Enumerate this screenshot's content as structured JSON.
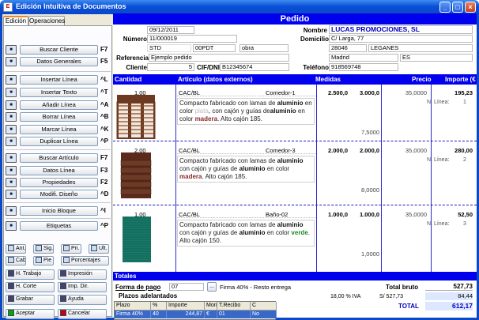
{
  "window": {
    "title": "Edición Intuitiva de Documentos"
  },
  "tabs": [
    "Edición",
    "Operaciones"
  ],
  "left_buttons": [
    {
      "label": "Buscar Cliente",
      "key": "F7",
      "icon": "client-search-icon"
    },
    {
      "label": "Datos Generales",
      "key": "F5",
      "icon": "general-data-icon"
    },
    {
      "label": "Insertar Línea",
      "key": "^L",
      "icon": "insert-line-icon"
    },
    {
      "label": "Insertar Texto",
      "key": "^T",
      "icon": "insert-text-icon"
    },
    {
      "label": "Añadir Línea",
      "key": "^A",
      "icon": "add-line-icon"
    },
    {
      "label": "Borrar Línea",
      "key": "^B",
      "icon": "delete-line-icon"
    },
    {
      "label": "Marcar Línea",
      "key": "^K",
      "icon": "mark-line-icon"
    },
    {
      "label": "Duplicar Línea",
      "key": "^P",
      "icon": "duplicate-line-icon"
    },
    {
      "label": "Buscar Artículo",
      "key": "F7",
      "icon": "article-search-icon"
    },
    {
      "label": "Datos Línea",
      "key": "F3",
      "icon": "line-data-icon"
    },
    {
      "label": "Propiedades",
      "key": "F2",
      "icon": "properties-icon"
    },
    {
      "label": "Modifi. Diseño",
      "key": "^D",
      "icon": "design-icon"
    },
    {
      "label": "Inicio Bloque",
      "key": "^I",
      "icon": "block-start-icon"
    },
    {
      "label": "Etiquetas",
      "key": "^P",
      "icon": "labels-icon"
    }
  ],
  "nav_buttons": [
    "Ant.",
    "Sig.",
    "Pri.",
    "Ult.",
    "Cab.",
    "Pie",
    "Porcentajes"
  ],
  "bottom_buttons": [
    "H. Trabajo",
    "Impresión",
    "H. Corte",
    "Imp. Dir.",
    "Grabar",
    "Ayuda",
    "Aceptar",
    "Cancelar"
  ],
  "header": {
    "title": "Pedido",
    "fecha_label": "Fecha",
    "fecha": "09/12/2011",
    "numero_label": "Número",
    "numero": "11/000019",
    "std": "STD",
    "ptd": "00PDT",
    "obra": "obra",
    "ref_label": "Referencia",
    "ref": "Ejemplo pedido",
    "cliente_label": "Cliente",
    "cliente": "5",
    "cif_label": "CIF/DNI",
    "cif": "B12345674",
    "nombre_label": "Nombre",
    "nombre": "LUCAS PROMOCIONES, SL",
    "domicilio_label": "Domicilio",
    "domicilio": "C/ Larga, 77",
    "cp": "28046",
    "ciudad": "LEGANES",
    "provincia": "Madrid",
    "pais": "ES",
    "telefono_label": "Teléfono",
    "telefono": "918569748"
  },
  "columns": [
    "Cantidad",
    "Artículo (datos externos)",
    "Medidas",
    "Precio",
    "Importe (€"
  ],
  "lines": [
    {
      "qty": "1,00",
      "code": "CAC/BL",
      "ref": "Comedor-1",
      "w": "2.500,0",
      "h": "3.000,0",
      "price": "35,0000",
      "amount": "195,23",
      "nl_label": "N. Línea:",
      "nl": "1",
      "area": "7,5000",
      "d1": "Compacto fabricado con lamas de ",
      "d1b": "aluminio",
      "d2": " en color ",
      "d2c": "plata",
      "d3": ", con cajón y guías de",
      "d4b": "aluminio",
      "d4": " en color ",
      "d4c": "madera",
      "d5": ". Alto cajón 185."
    },
    {
      "qty": "2,00",
      "code": "CAC/BL",
      "ref": "Comedor-3",
      "w": "2.000,0",
      "h": "2.000,0",
      "price": "35,0000",
      "amount": "280,00",
      "nl_label": "N. Línea:",
      "nl": "2",
      "area": "8,0000",
      "d1": "Compacto fabricado con lamas de ",
      "d1b": "aluminio",
      "d2": " con cajón y guías de ",
      "d2b": "aluminio",
      "d3": " en",
      "d4": " color ",
      "d4c": "madera",
      "d5": ". Alto cajón 185."
    },
    {
      "qty": "1,00",
      "code": "CAC/BL",
      "ref": "Baño-02",
      "w": "1.000,0",
      "h": "1.000,0",
      "price": "35,0000",
      "amount": "52,50",
      "nl_label": "N. Línea:",
      "nl": "3",
      "area": "1,0000",
      "d1": "Compacto fabricado con lamas de ",
      "d1b": "aluminio",
      "d2": " con cajón y guías de ",
      "d2b": "aluminio",
      "d3": " en",
      "d4": " color ",
      "d4c": "verde",
      "d5": ". Alto cajón 150."
    }
  ],
  "totals": {
    "title": "Totales",
    "forma_pago_label": "Forma de pago",
    "forma_pago": "07",
    "forma_pago_desc": "Firma 40% - Resto entrega",
    "plazos_label": "Plazos adelantados",
    "iva": "18,00 % IVA",
    "bruto_label": "Total bruto",
    "bruto": "527,73",
    "s_label": "S/ 527,73",
    "iva_amount": "84,44",
    "total_label": "TOTAL",
    "total": "612,17"
  },
  "grid": {
    "headers": [
      "Plazo",
      "%",
      "Importe",
      "Mon",
      "T.Recibo",
      "C"
    ],
    "row": [
      "Firma 40%",
      "40",
      "244,87",
      "€",
      "01",
      "No"
    ]
  }
}
